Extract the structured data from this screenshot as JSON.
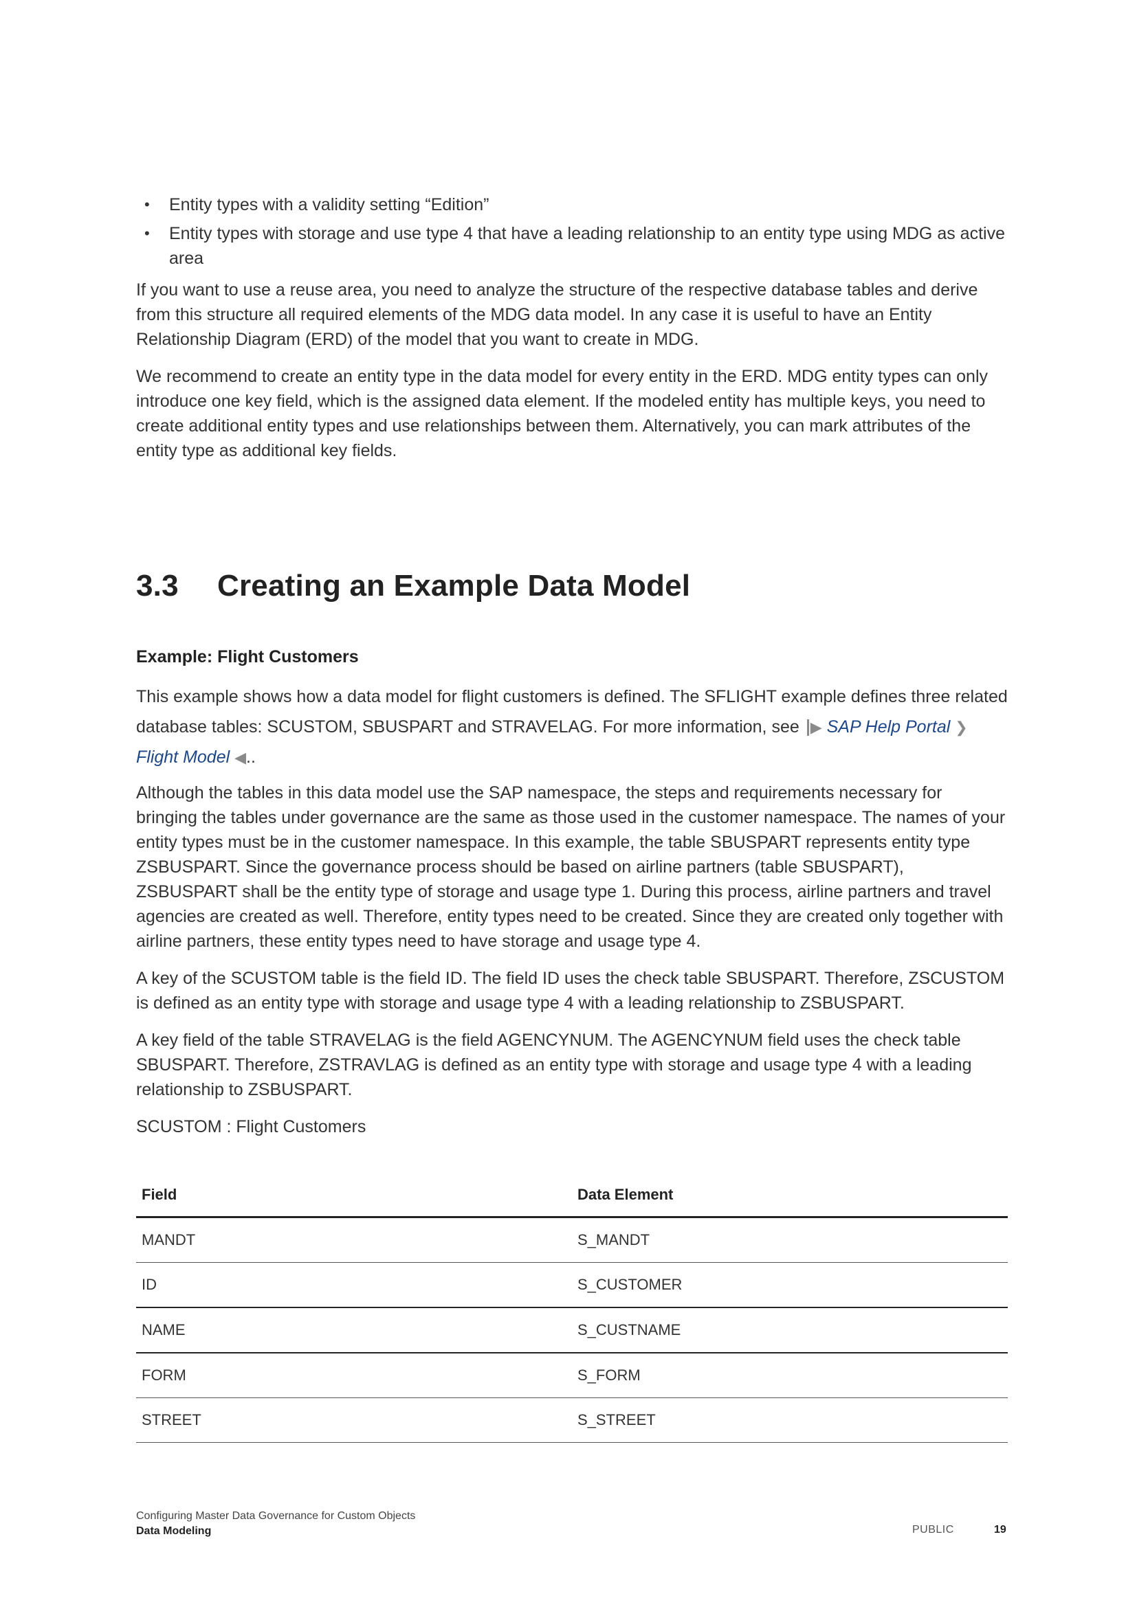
{
  "intro": {
    "bullets": [
      "Entity types with a validity setting “Edition”",
      "Entity types with storage and use type 4 that have a leading relationship to an entity type using MDG as active area"
    ],
    "paragraphs": [
      "If you want to use a reuse area, you need to analyze the structure of the respective database tables and derive from this structure all required elements of the MDG data model. In any case it is useful to have an Entity Relationship Diagram (ERD) of the model that you want to create in MDG.",
      "We recommend to create an entity type in the data model for every entity in the ERD. MDG entity types can only introduce one key field, which is the assigned data element. If the modeled entity has multiple keys, you need to create additional entity types and use relationships between them. Alternatively, you can mark attributes of the entity type as additional key fields."
    ]
  },
  "section": {
    "number": "3.3",
    "title": "Creating an Example Data Model"
  },
  "example": {
    "heading": "Example: Flight Customers",
    "para1_text": "This example shows how a data model for flight customers is defined. The SFLIGHT example defines three related database tables: SCUSTOM, SBUSPART and STRAVELAG. For more information, see",
    "link1": "SAP Help Portal",
    "link2": "Flight Model",
    "para1_end": "..",
    "paragraphs": [
      "Although the tables in this data model use the SAP namespace, the steps and requirements necessary for bringing the tables under governance are the same as those used in the customer namespace. The names of your entity types must be in the customer namespace. In this example, the table SBUSPART represents entity type ZSBUSPART. Since the governance process should be based on airline partners (table SBUSPART), ZSBUSPART shall be the entity type of storage and usage type 1. During this process, airline partners and travel agencies are created as well. Therefore, entity types need to be created. Since they are created only together with airline partners, these entity types need to have storage and usage type 4.",
      "A key of the SCUSTOM table is the field ID. The field ID uses the check table SBUSPART. Therefore, ZSCUSTOM is defined as an entity type with storage and usage type 4 with a leading relationship to ZSBUSPART.",
      "A key field of the table STRAVELAG is the field AGENCYNUM. The AGENCYNUM field uses the check table SBUSPART. Therefore, ZSTRAVLAG is defined as an entity type with storage and usage type 4 with a leading relationship to ZSBUSPART."
    ],
    "table_caption": "SCUSTOM : Flight Customers"
  },
  "table": {
    "headers": [
      "Field",
      "Data Element"
    ],
    "rows": [
      [
        "MANDT",
        "S_MANDT"
      ],
      [
        "ID",
        "S_CUSTOMER"
      ],
      [
        "NAME",
        "S_CUSTNAME"
      ],
      [
        "FORM",
        "S_FORM"
      ],
      [
        "STREET",
        "S_STREET"
      ]
    ]
  },
  "footer": {
    "doc_title": "Configuring Master Data Governance for Custom Objects",
    "chapter": "Data Modeling",
    "classification": "PUBLIC",
    "page_number": "19"
  },
  "colors": {
    "text": "#333333",
    "link": "#1f4788",
    "heading": "#222222"
  }
}
